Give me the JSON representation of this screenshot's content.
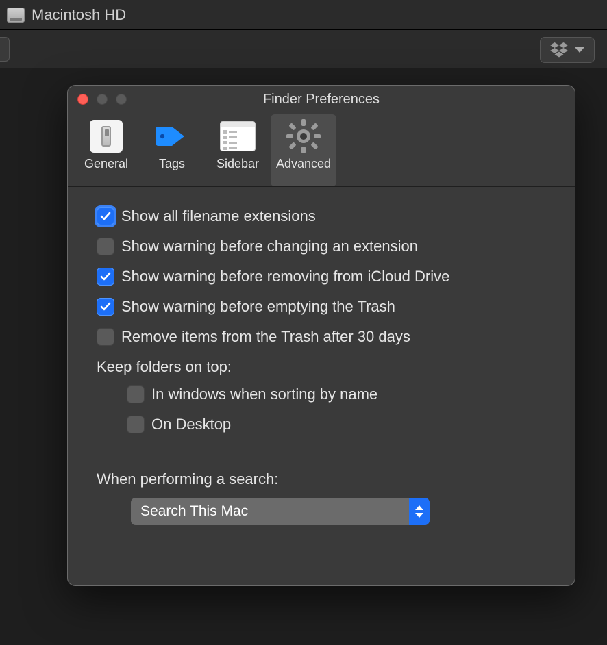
{
  "finder": {
    "window_title": "Macintosh HD",
    "toolbar": {
      "dropbox_icon": "dropbox-icon"
    }
  },
  "prefs": {
    "title": "Finder Preferences",
    "tabs": [
      {
        "label": "General",
        "selected": false
      },
      {
        "label": "Tags",
        "selected": false
      },
      {
        "label": "Sidebar",
        "selected": false
      },
      {
        "label": "Advanced",
        "selected": true
      }
    ],
    "checks": {
      "show_ext": {
        "label": "Show all filename extensions",
        "checked": true,
        "focused": true
      },
      "warn_ext": {
        "label": "Show warning before changing an extension",
        "checked": false
      },
      "warn_icloud": {
        "label": "Show warning before removing from iCloud Drive",
        "checked": true
      },
      "warn_trash": {
        "label": "Show warning before emptying the Trash",
        "checked": true
      },
      "trash_30": {
        "label": "Remove items from the Trash after 30 days",
        "checked": false
      }
    },
    "keep_on_top": {
      "heading": "Keep folders on top:",
      "windows": {
        "label": "In windows when sorting by name",
        "checked": false
      },
      "desktop": {
        "label": "On Desktop",
        "checked": false
      }
    },
    "search": {
      "heading": "When performing a search:",
      "selected": "Search This Mac"
    }
  }
}
